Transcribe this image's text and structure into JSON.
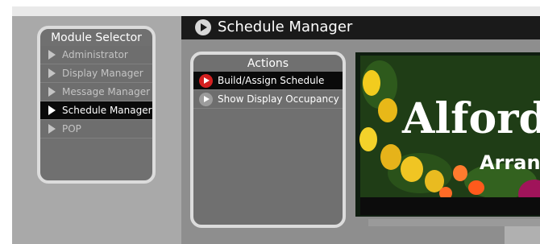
{
  "header": {
    "title": "Schedule Manager",
    "icon": "play-circle-icon"
  },
  "module_selector": {
    "title": "Module Selector",
    "items": [
      {
        "label": "Administrator",
        "active": false
      },
      {
        "label": "Display Manager",
        "active": false
      },
      {
        "label": "Message Manager",
        "active": false
      },
      {
        "label": "Schedule Manager",
        "active": true
      },
      {
        "label": "POP",
        "active": false
      }
    ]
  },
  "actions": {
    "title": "Actions",
    "items": [
      {
        "label": "Build/Assign Schedule",
        "active": true,
        "icon": "red-play-circle-icon"
      },
      {
        "label": "Show Display Occupancy",
        "active": false,
        "icon": "gray-play-circle-icon"
      }
    ]
  },
  "preview": {
    "headline": "Alford",
    "subline": "Arran"
  },
  "colors": {
    "header_bg": "#1a1a1a",
    "active_bg": "#0a0a0a",
    "accent_red": "#d42020",
    "panel_border": "#dcdcdc"
  }
}
